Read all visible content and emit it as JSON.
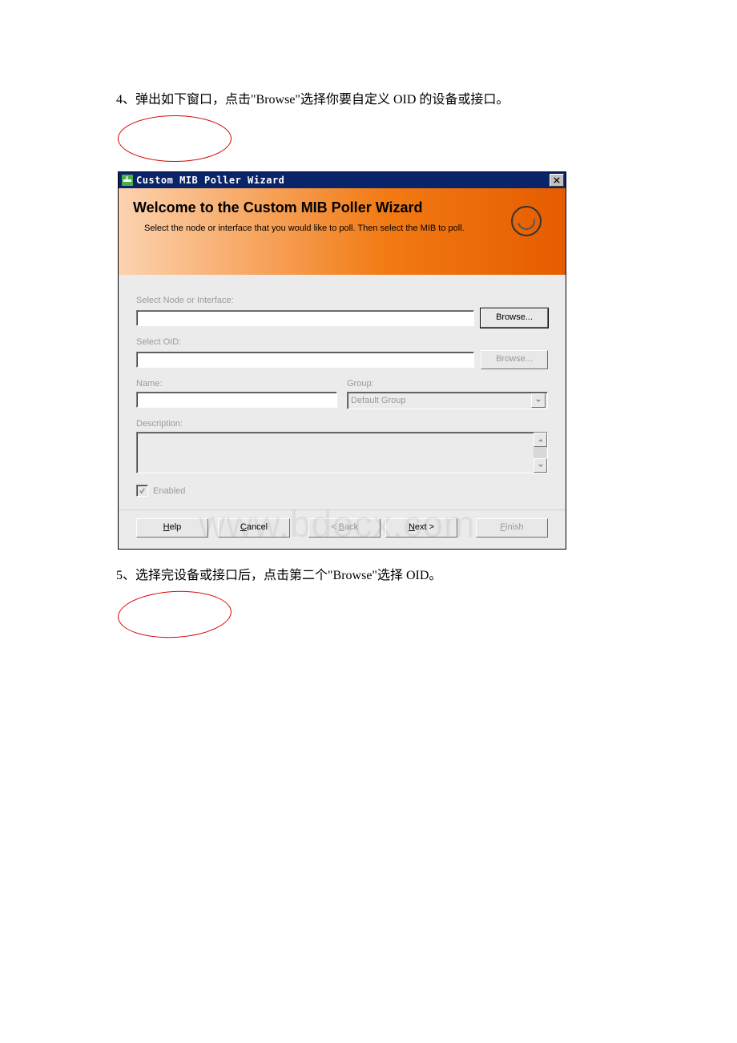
{
  "doc": {
    "step4": "4、弹出如下窗口，点击\"Browse\"选择你要自定义 OID 的设备或接口。",
    "step5": "5、选择完设备或接口后，点击第二个\"Browse\"选择 OID。"
  },
  "dialog": {
    "title": "Custom MIB Poller Wizard",
    "header_title": "Welcome to the Custom MIB Poller Wizard",
    "header_desc": "Select the node or interface that you would like to poll. Then select the MIB to poll.",
    "labels": {
      "select_node": "Select Node or Interface:",
      "select_oid": "Select OID:",
      "name": "Name:",
      "group": "Group:",
      "description": "Description:",
      "enabled": "Enabled"
    },
    "values": {
      "group_default": "Default Group"
    },
    "buttons": {
      "browse1": "Browse...",
      "browse2": "Browse...",
      "help": "Help",
      "cancel": "Cancel",
      "back": "< Back",
      "next": "Next >",
      "finish": "Finish"
    },
    "watermark": "www.bdocx.com"
  }
}
